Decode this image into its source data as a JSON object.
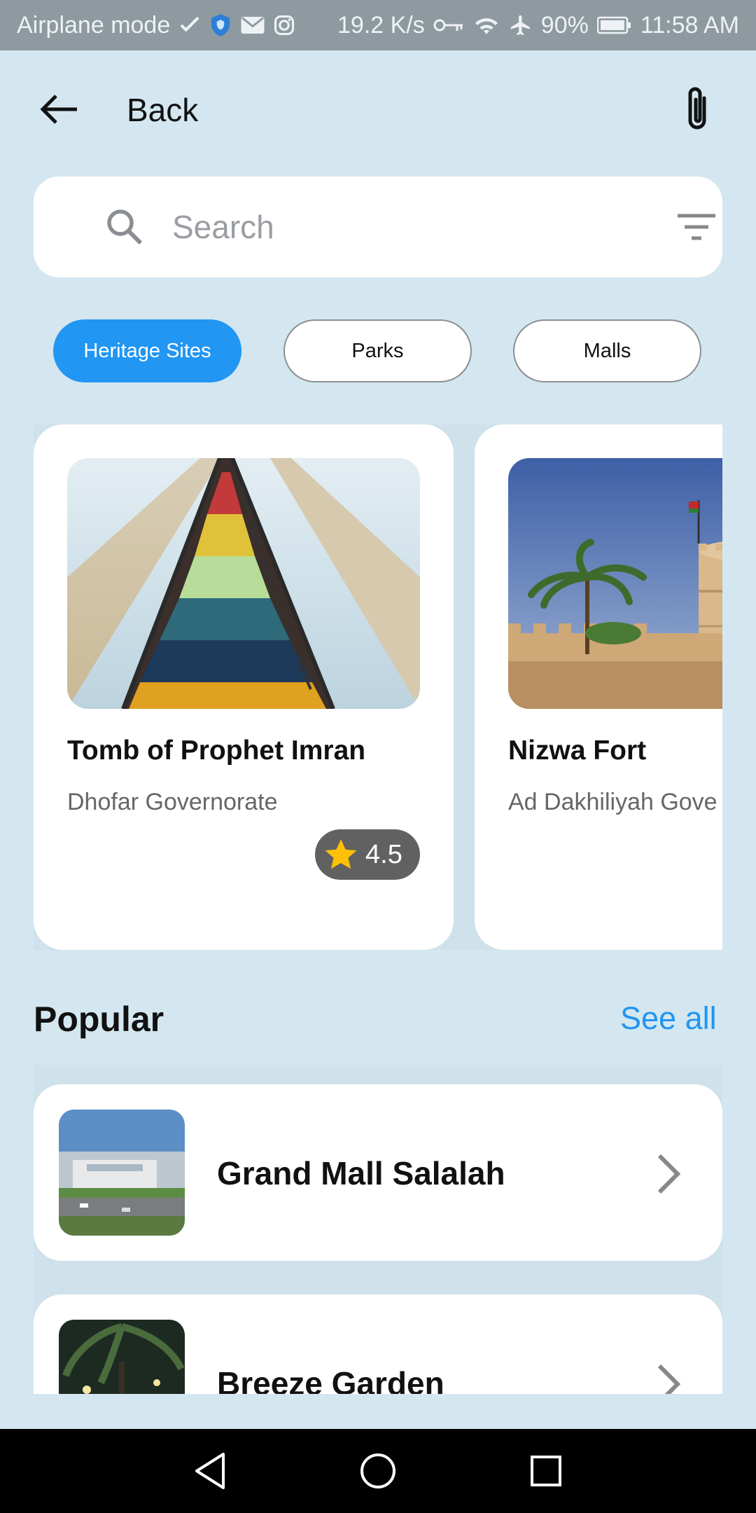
{
  "status_bar": {
    "left_text": "Airplane mode",
    "speed": "19.2 K/s",
    "battery": "90%",
    "time": "11:58 AM"
  },
  "header": {
    "back_label": "Back",
    "back_icon": "arrow-left-icon",
    "action_icon": "paperclip-icon"
  },
  "search": {
    "placeholder": "Search",
    "value": ""
  },
  "categories": [
    {
      "label": "Heritage Sites",
      "selected": true
    },
    {
      "label": "Parks",
      "selected": false
    },
    {
      "label": "Malls",
      "selected": false
    }
  ],
  "places": [
    {
      "title": "Tomb of Prophet Imran",
      "region": "Dhofar Governorate",
      "rating": "4.5"
    },
    {
      "title": "Nizwa Fort",
      "region": "Ad Dakhiliyah Gove",
      "rating": ""
    }
  ],
  "popular": {
    "title": "Popular",
    "see_all": "See all",
    "items": [
      {
        "title": "Grand Mall Salalah"
      },
      {
        "title": "Breeze Garden"
      }
    ]
  },
  "colors": {
    "accent": "#2196f3",
    "background": "#d4e7f0",
    "rating_bg": "#616161",
    "star": "#ffc107"
  }
}
